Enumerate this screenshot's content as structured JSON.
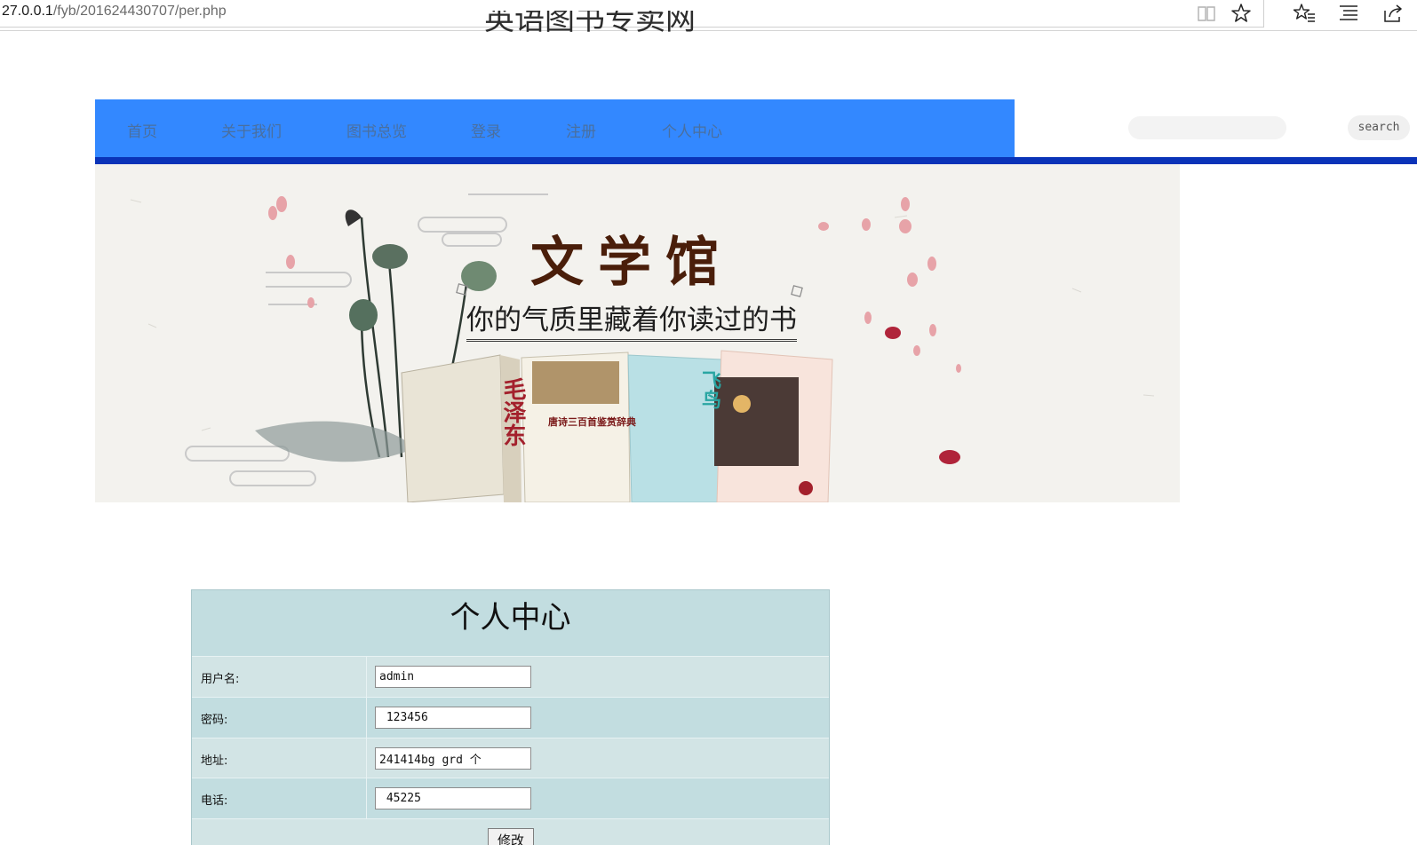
{
  "browser": {
    "url_host": "27.0.0.1",
    "url_path": "/fyb/201624430707/per.php",
    "icons": [
      "reading-view-icon",
      "favorite-star-icon",
      "favorites-list-icon",
      "hub-icon",
      "share-icon"
    ]
  },
  "site": {
    "title": "英语图书专卖网"
  },
  "nav": {
    "items": [
      {
        "label": "首页"
      },
      {
        "label": "关于我们"
      },
      {
        "label": "图书总览"
      },
      {
        "label": "登录"
      },
      {
        "label": "注册"
      },
      {
        "label": "个人中心"
      }
    ]
  },
  "search": {
    "placeholder": "",
    "button_label": "search"
  },
  "banner": {
    "title": "文学馆",
    "slogan": "你的气质里藏着你读过的书",
    "book_titles": [
      "毛泽东",
      "唐诗三百首鉴赏辞典",
      "飞鸟"
    ]
  },
  "profile": {
    "title": "个人中心",
    "fields": [
      {
        "label": "用户名:",
        "value": "admin"
      },
      {
        "label": "密码:",
        "value": " 123456"
      },
      {
        "label": "地址:",
        "value": "241414bg grd 个"
      },
      {
        "label": "电话:",
        "value": " 45225"
      }
    ],
    "submit_label": "修改"
  },
  "colors": {
    "nav_bg": "#3388ff",
    "nav_line": "#0a33b8",
    "panel_bg": "#c2dde0",
    "panel_row_alt": "#d2e4e5"
  }
}
